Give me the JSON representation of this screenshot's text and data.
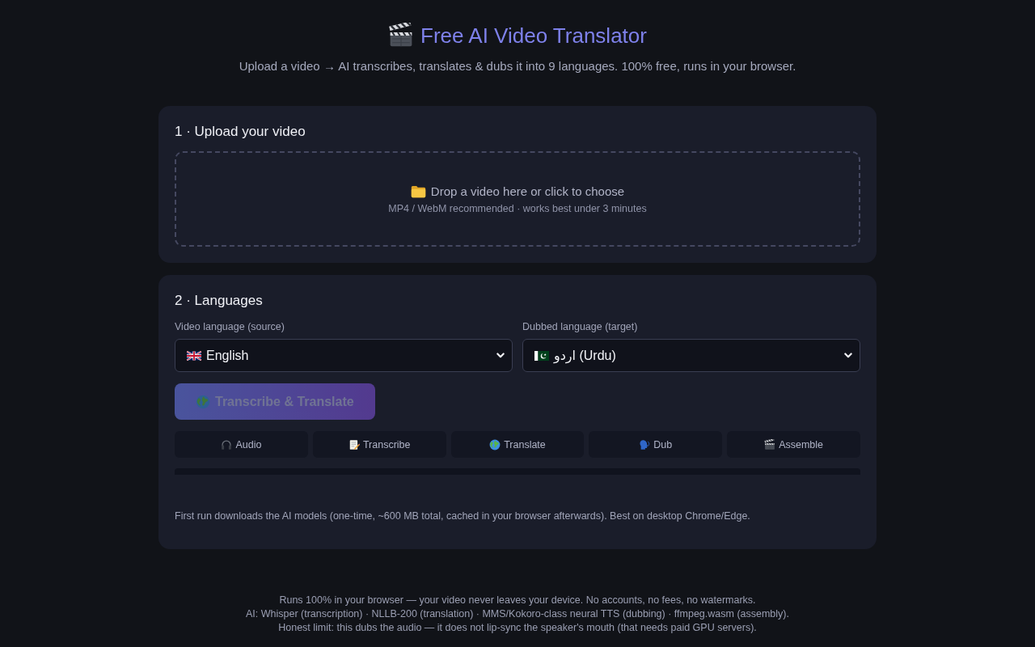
{
  "header": {
    "title": "Free AI Video Translator",
    "subtitle": "Upload a video → AI transcribes, translates & dubs it into 9 languages. 100% free, runs in your browser."
  },
  "upload_card": {
    "heading": "1 · Upload your video",
    "dropzone": {
      "prompt": "Drop a video here or click to choose",
      "hint": "MP4 / WebM recommended · works best under 3 minutes"
    }
  },
  "languages_card": {
    "heading": "2 · Languages",
    "fields": [
      {
        "label": "Video language (source)",
        "value": "English"
      },
      {
        "label": "Dubbed language (target)",
        "value": "اردو (Urdu)"
      }
    ],
    "action_button": {
      "label": "Transcribe & Translate",
      "disabled": true
    },
    "steps": [
      {
        "label": "Audio"
      },
      {
        "label": "Transcribe"
      },
      {
        "label": "Translate"
      },
      {
        "label": "Dub"
      },
      {
        "label": "Assemble"
      }
    ],
    "note": "First run downloads the AI models (one-time, ~600 MB total, cached in your browser afterwards). Best on desktop Chrome/Edge."
  },
  "footer": {
    "lines": [
      "Runs 100% in your browser — your video never leaves your device. No accounts, no fees, no watermarks.",
      "AI: Whisper (transcription) · NLLB-200 (translation) · MMS/Kokoro-class neural TTS (dubbing) · ffmpeg.wasm (assembly).",
      "Honest limit: this dubs the audio — it does not lip-sync the speaker's mouth (that needs paid GPU servers)."
    ]
  }
}
